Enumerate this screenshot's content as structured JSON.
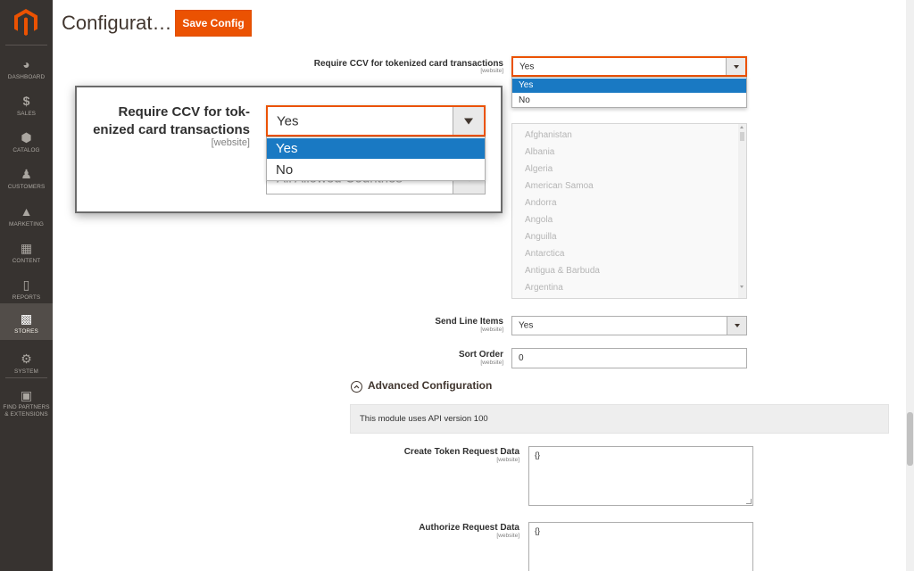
{
  "header": {
    "title": "Configurat…",
    "save_label": "Save Config"
  },
  "sidebar": {
    "items": [
      {
        "label": "DASHBOARD",
        "icon": "dashboard-icon"
      },
      {
        "label": "SALES",
        "icon": "dollar-icon"
      },
      {
        "label": "CATALOG",
        "icon": "cube-icon"
      },
      {
        "label": "CUSTOMERS",
        "icon": "person-icon"
      },
      {
        "label": "MARKETING",
        "icon": "megaphone-icon"
      },
      {
        "label": "CONTENT",
        "icon": "layout-icon"
      },
      {
        "label": "REPORTS",
        "icon": "bar-chart-icon"
      },
      {
        "label": "STORES",
        "icon": "store-icon",
        "active": true
      },
      {
        "label": "SYSTEM",
        "icon": "gear-icon"
      },
      {
        "label_line1": "FIND PARTNERS",
        "label_line2": "& EXTENSIONS",
        "icon": "box-icon"
      }
    ]
  },
  "ccv": {
    "label": "Require CCV for tokenized card transactions",
    "scope": "[website]",
    "value": "Yes",
    "options": [
      "Yes",
      "No"
    ]
  },
  "countries": [
    "Afghanistan",
    "Albania",
    "Algeria",
    "American Samoa",
    "Andorra",
    "Angola",
    "Anguilla",
    "Antarctica",
    "Antigua & Barbuda",
    "Argentina"
  ],
  "send_line_items": {
    "label": "Send Line Items",
    "scope": "[website]",
    "value": "Yes"
  },
  "sort_order": {
    "label": "Sort Order",
    "scope": "[website]",
    "value": "0"
  },
  "advanced": {
    "title": "Advanced Configuration",
    "note": "This module uses API version 100"
  },
  "create_token": {
    "label": "Create Token Request Data",
    "scope": "[website]",
    "value": "{}"
  },
  "authorize": {
    "label": "Authorize Request Data",
    "scope": "[website]",
    "value": "{}"
  },
  "zoom": {
    "label_line1": "Require CCV for tok-",
    "label_line2": "enized card transactions",
    "scope": "[website]",
    "value": "Yes",
    "options": [
      "Yes",
      "No"
    ],
    "behind_value": "All Allowed Countries"
  },
  "colors": {
    "accent": "#eb5202",
    "sidebar": "#373330",
    "selected": "#1979c3"
  }
}
